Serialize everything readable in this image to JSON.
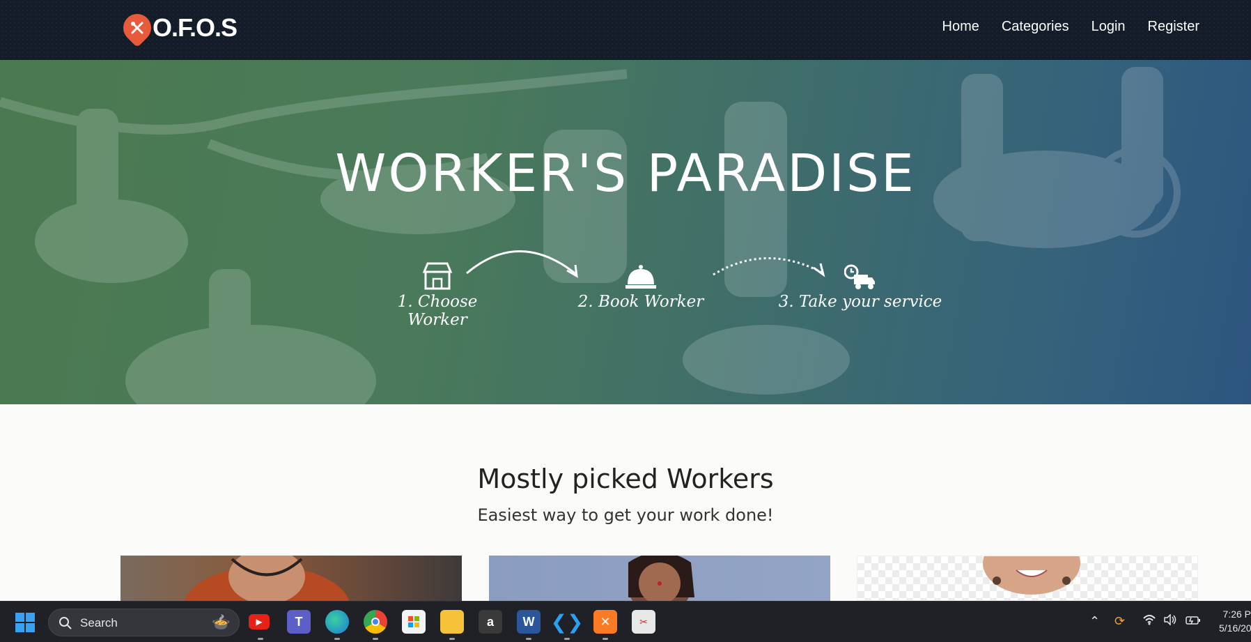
{
  "brand": {
    "logo_text": "O.F.O.S"
  },
  "nav": {
    "items": [
      "Home",
      "Categories",
      "Login",
      "Register"
    ]
  },
  "hero": {
    "title": "WORKER'S PARADISE",
    "steps": [
      {
        "label": "1. Choose Worker",
        "icon": "storefront-icon"
      },
      {
        "label": "2. Book Worker",
        "icon": "service-bell-icon"
      },
      {
        "label": "3. Take your service",
        "icon": "delivery-truck-icon"
      }
    ]
  },
  "section": {
    "title": "Mostly picked Workers",
    "subtitle": "Easiest way to get your work done!"
  },
  "taskbar": {
    "search_placeholder": "Search",
    "apps": [
      "youtube-icon",
      "teams-icon",
      "edge-icon",
      "chrome-icon",
      "store-icon",
      "file-explorer-icon",
      "amazon-icon",
      "word-icon",
      "vscode-icon",
      "xampp-icon",
      "snipping-tool-icon"
    ],
    "clock_time": "7:26 P",
    "clock_date": "5/16/20"
  },
  "colors": {
    "navbar": "#141c29",
    "logo_accent": "#e85a3c",
    "hero_left": "#4b7a50",
    "hero_right": "#2d557f"
  }
}
